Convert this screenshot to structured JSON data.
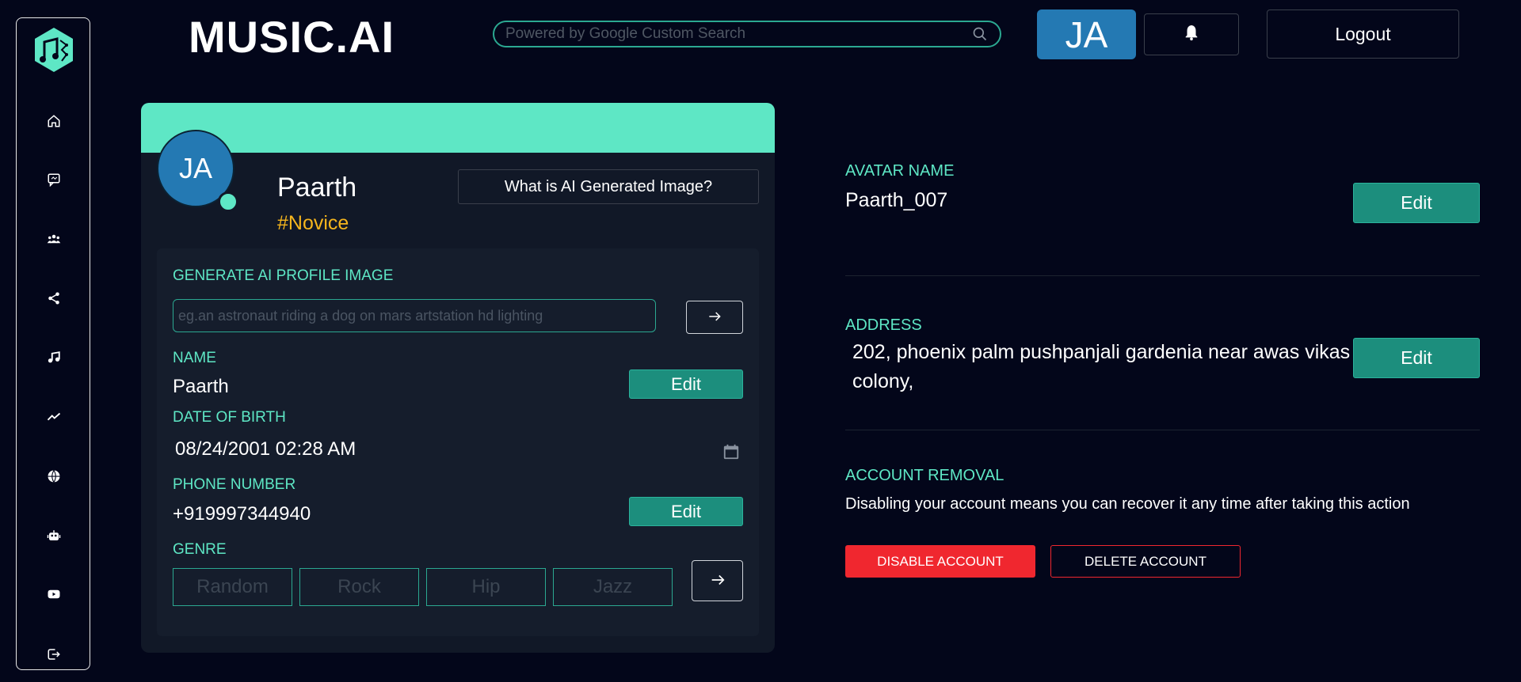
{
  "brand": {
    "title": "MUSIC.AI"
  },
  "header": {
    "search_placeholder": "Powered by Google Custom Search",
    "avatar_initials": "JA",
    "logout_label": "Logout"
  },
  "sidebar": {
    "items": [
      {
        "icon": "home-icon"
      },
      {
        "icon": "chat-icon"
      },
      {
        "icon": "community-icon"
      },
      {
        "icon": "share-icon"
      },
      {
        "icon": "music-note-icon"
      },
      {
        "icon": "trending-icon"
      },
      {
        "icon": "globe-icon"
      },
      {
        "icon": "robot-icon"
      },
      {
        "icon": "youtube-icon"
      },
      {
        "icon": "logout-icon"
      }
    ]
  },
  "profile": {
    "initials": "JA",
    "name": "Paarth",
    "rank": "#Novice",
    "ai_button_label": "What is AI Generated Image?",
    "generate_label": "GENERATE AI PROFILE IMAGE",
    "generate_placeholder": "eg.an astronaut riding a dog on mars artstation hd lighting",
    "name_label": "NAME",
    "name_value": "Paarth",
    "edit_label": "Edit",
    "dob_label": "DATE OF BIRTH",
    "dob_value": "08/24/2001 02:28 AM",
    "phone_label": "PHONE NUMBER",
    "phone_value": "+919997344940",
    "genre_label": "GENRE",
    "genres": [
      "Random",
      "Rock",
      "Hip",
      "Jazz"
    ]
  },
  "settings": {
    "avatar_name_label": "AVATAR NAME",
    "avatar_name_value": "Paarth_007",
    "address_label": "ADDRESS",
    "address_value": "202, phoenix palm pushpanjali gardenia near awas vikas colony,",
    "edit_label": "Edit",
    "removal_label": "ACCOUNT REMOVAL",
    "removal_text": "Disabling your account means you can recover it any time after taking this action",
    "disable_label": "DISABLE ACCOUNT",
    "delete_label": "DELETE ACCOUNT"
  },
  "colors": {
    "background": "#03061a",
    "accent": "#5ee7c5",
    "teal_button": "#1c8e7d",
    "avatar_blue": "#2479b3",
    "rank_gold": "#f5b51d",
    "danger": "#f0272f"
  }
}
